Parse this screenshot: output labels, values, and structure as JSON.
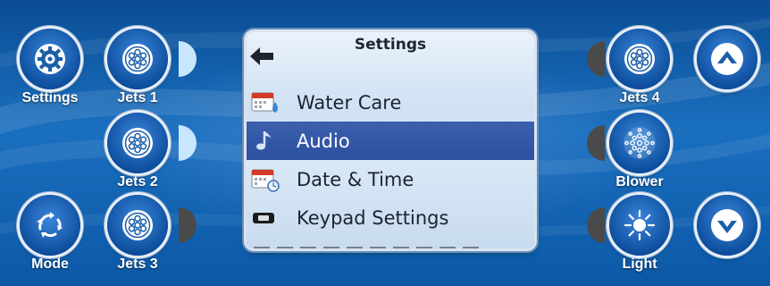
{
  "left_buttons": {
    "settings": {
      "label": "Settings",
      "icon": "gear-icon"
    },
    "jets1": {
      "label": "Jets 1",
      "icon": "jets-icon"
    },
    "jets2": {
      "label": "Jets 2",
      "icon": "jets-icon"
    },
    "mode": {
      "label": "Mode",
      "icon": "mode-cycle-icon"
    },
    "jets3": {
      "label": "Jets 3",
      "icon": "jets-icon"
    }
  },
  "right_buttons": {
    "jets4": {
      "label": "Jets 4",
      "icon": "jets-icon"
    },
    "blower": {
      "label": "Blower",
      "icon": "blower-icon"
    },
    "light": {
      "label": "Light",
      "icon": "light-icon"
    },
    "up": {
      "icon": "up-arrow-icon"
    },
    "down": {
      "icon": "down-arrow-icon"
    }
  },
  "screen": {
    "title": "Settings",
    "back_icon": "back-arrow-icon",
    "items": [
      {
        "label": "Water Care",
        "icon": "calendar-drop-icon",
        "selected": false
      },
      {
        "label": "Audio",
        "icon": "music-note-icon",
        "selected": true
      },
      {
        "label": "Date & Time",
        "icon": "calendar-clock-icon",
        "selected": false
      },
      {
        "label": "Keypad Settings",
        "icon": "keypad-icon",
        "selected": false
      }
    ]
  },
  "colors": {
    "panel_blue": "#1a6fbf",
    "button_blue": "#0e4f9e",
    "selected_row": "#2d4f9f",
    "indicator_on": "#c9e6ff",
    "indicator_off": "#4a4a4a"
  },
  "indicators": {
    "jets1": "on",
    "jets2": "on",
    "jets3": "off",
    "jets4": "off",
    "blower": "off",
    "light": "off"
  }
}
